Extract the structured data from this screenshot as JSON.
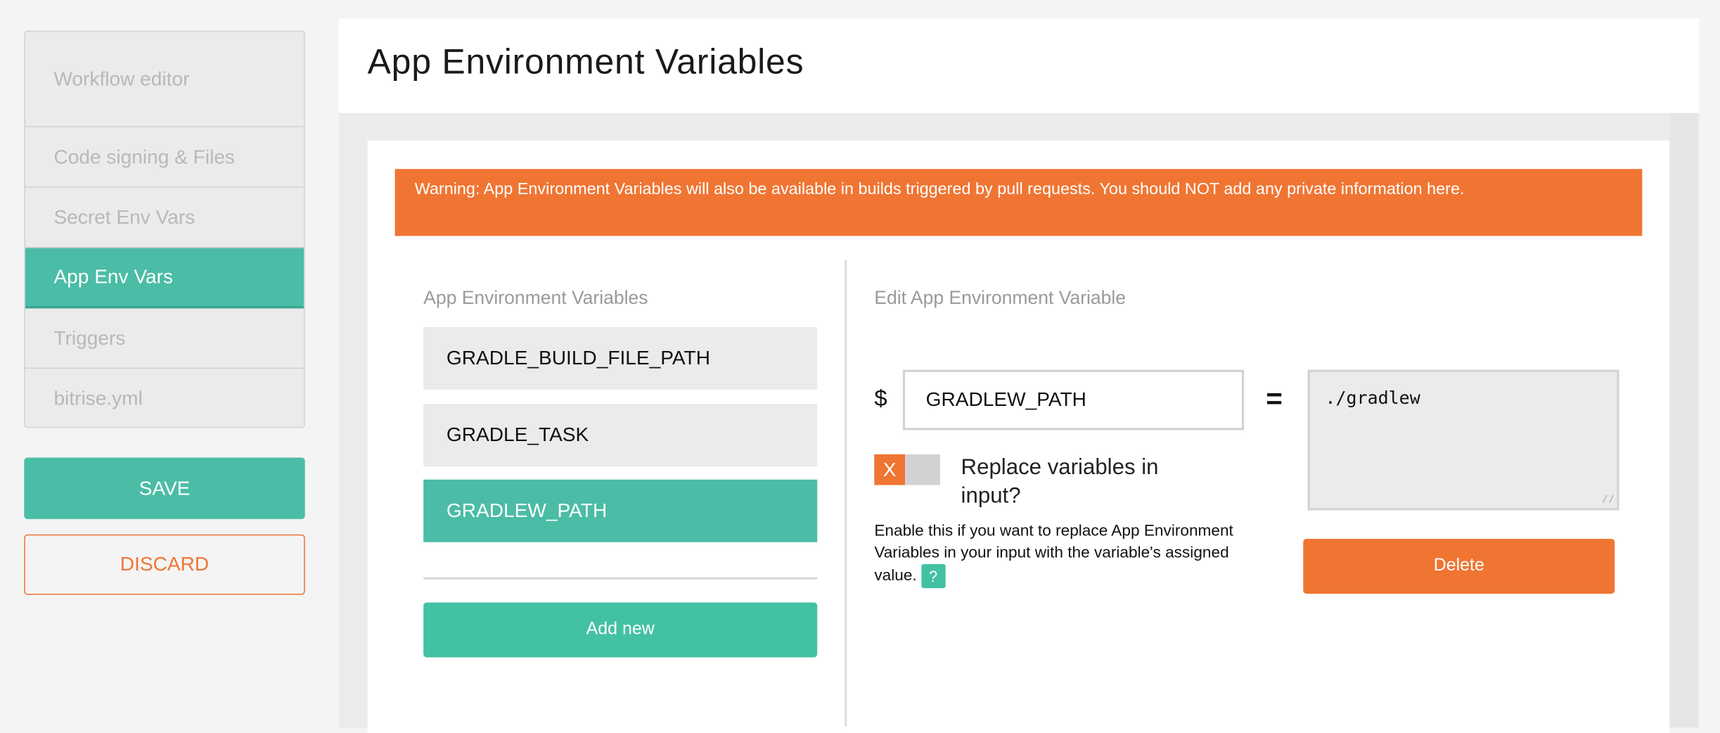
{
  "sidebar": {
    "items": [
      {
        "label": "Workflow editor",
        "active": false
      },
      {
        "label": "Code signing & Files",
        "active": false
      },
      {
        "label": "Secret Env Vars",
        "active": false
      },
      {
        "label": "App Env Vars",
        "active": true
      },
      {
        "label": "Triggers",
        "active": false
      },
      {
        "label": "bitrise.yml",
        "active": false
      }
    ],
    "save_label": "SAVE",
    "discard_label": "DISCARD"
  },
  "page": {
    "title": "App Environment Variables"
  },
  "warning": "Warning: App Environment Variables will also be available in builds triggered by pull requests. You should NOT add any private information here.",
  "list": {
    "heading": "App Environment Variables",
    "items": [
      "GRADLE_BUILD_FILE_PATH",
      "GRADLE_TASK",
      "GRADLEW_PATH"
    ],
    "selected_index": 2,
    "add_label": "Add new"
  },
  "editor": {
    "heading": "Edit App Environment Variable",
    "dollar": "$",
    "equals": "=",
    "key": "GRADLEW_PATH",
    "value": "./gradlew",
    "toggle_icon": "X",
    "toggle_on": false,
    "replace_label": "Replace variables in input?",
    "help_text": "Enable this if you want to replace App Environment Variables in your input with the variable's assigned value.",
    "help_icon": "?",
    "delete_label": "Delete"
  },
  "colors": {
    "accent": "#4bbca5",
    "warning": "#f07533"
  }
}
